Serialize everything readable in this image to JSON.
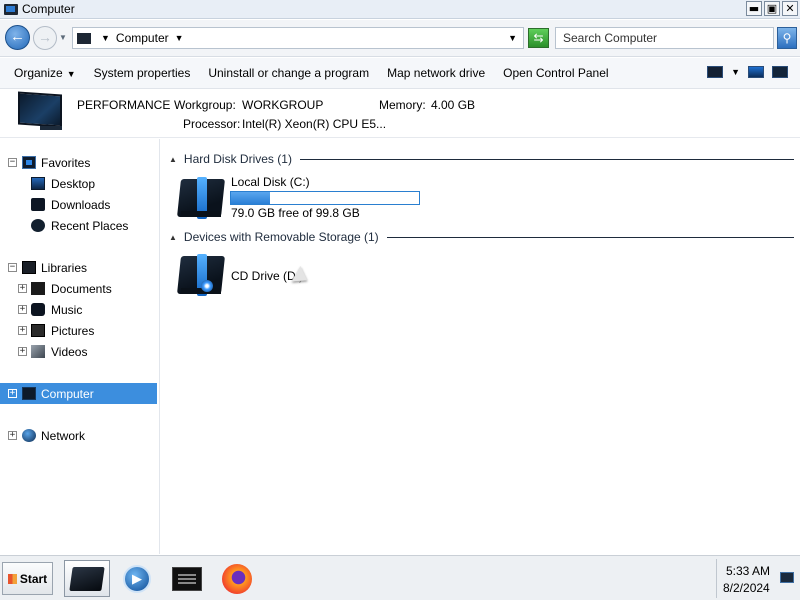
{
  "window": {
    "title": "Computer",
    "controls": {
      "minimize": "▬",
      "maximize": "▣",
      "close": "✕"
    }
  },
  "addressbar": {
    "back_glyph": "←",
    "forward_glyph": "→",
    "breadcrumb": "Computer",
    "search_placeholder": "Search Computer",
    "search_glyph": "⚲",
    "refresh_glyph": "⇆"
  },
  "toolbar": {
    "items": [
      {
        "label": "Organize",
        "has_dropdown": true
      },
      {
        "label": "System properties"
      },
      {
        "label": "Uninstall or change a program"
      },
      {
        "label": "Map network drive"
      },
      {
        "label": "Open Control Panel"
      }
    ],
    "dropdown_glyph": "▼"
  },
  "details": {
    "computer_name": "PERFORMANCE",
    "workgroup_label": "Workgroup:",
    "workgroup_value": "WORKGROUP",
    "memory_label": "Memory:",
    "memory_value": "4.00 GB",
    "processor_label": "Processor:",
    "processor_value": "Intel(R) Xeon(R) CPU E5..."
  },
  "navigation": {
    "expand_glyph": "+",
    "collapse_glyph": "−",
    "favorites": {
      "label": "Favorites",
      "icon": "favorites-icon",
      "items": [
        {
          "label": "Desktop",
          "icon": "desktop-icon"
        },
        {
          "label": "Downloads",
          "icon": "downloads-icon"
        },
        {
          "label": "Recent Places",
          "icon": "recent-places-icon"
        }
      ]
    },
    "libraries": {
      "label": "Libraries",
      "icon": "libraries-icon",
      "items": [
        {
          "label": "Documents",
          "icon": "documents-icon"
        },
        {
          "label": "Music",
          "icon": "music-icon"
        },
        {
          "label": "Pictures",
          "icon": "pictures-icon"
        },
        {
          "label": "Videos",
          "icon": "videos-icon"
        }
      ]
    },
    "computer": {
      "label": "Computer",
      "icon": "computer-icon",
      "selected": true
    },
    "network": {
      "label": "Network",
      "icon": "network-icon"
    }
  },
  "content": {
    "groups": [
      {
        "header": "Hard Disk Drives (1)",
        "drives": [
          {
            "name": "Local Disk (C:)",
            "free_text": "79.0 GB free of 99.8 GB",
            "used_fraction": 0.208
          }
        ]
      },
      {
        "header": "Devices with Removable Storage (1)",
        "drives": [
          {
            "name": "CD Drive (D:)"
          }
        ]
      }
    ],
    "collapse_glyph": "▲"
  },
  "taskbar": {
    "start_label": "Start",
    "apps": [
      {
        "name": "windows-explorer",
        "active": true
      },
      {
        "name": "media-player"
      },
      {
        "name": "command-prompt"
      },
      {
        "name": "firefox"
      }
    ],
    "media_glyph": "▶",
    "clock_time": "5:33 AM",
    "clock_date": "8/2/2024"
  },
  "colors": {
    "selection": "#3c8ede",
    "progress_fill": "#2a7fd6",
    "title_bar": "#e8eef6"
  }
}
